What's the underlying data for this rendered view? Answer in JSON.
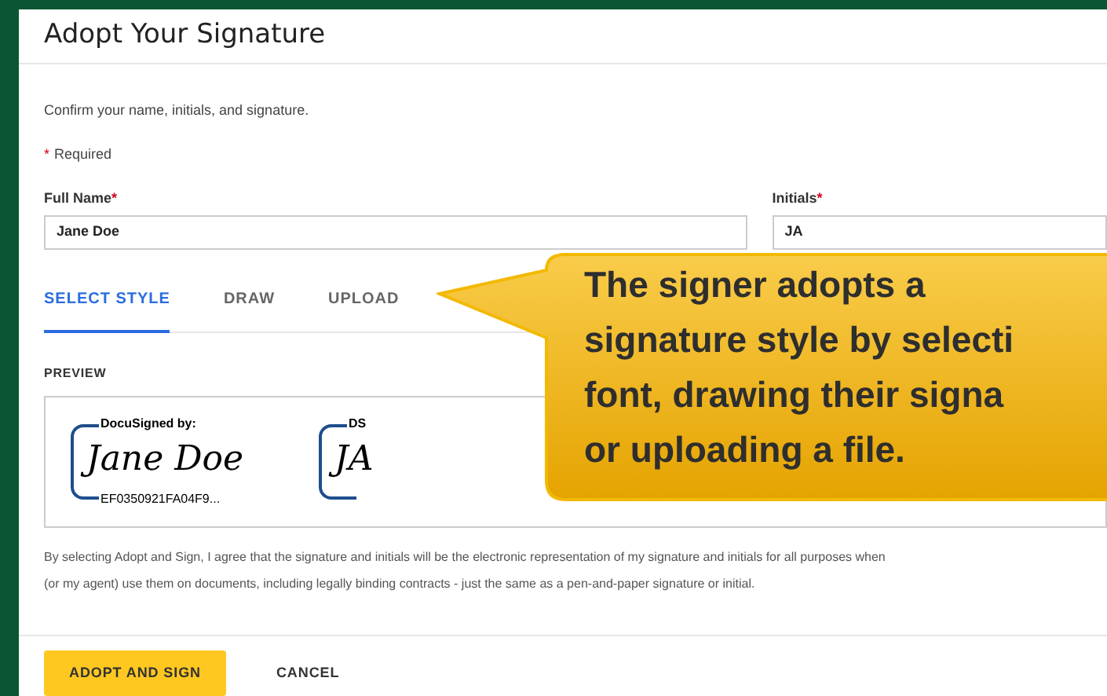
{
  "dialog": {
    "title": "Adopt Your Signature"
  },
  "intro": "Confirm your name, initials, and signature.",
  "required_note": {
    "mark": "*",
    "text": "Required"
  },
  "fields": [
    {
      "label": "Full Name",
      "required": true,
      "value": "Jane Doe"
    },
    {
      "label": "Initials",
      "required": true,
      "value": "JA"
    }
  ],
  "tabs": [
    {
      "label": "SELECT STYLE",
      "selected": true
    },
    {
      "label": "DRAW",
      "selected": false
    },
    {
      "label": "UPLOAD",
      "selected": false
    }
  ],
  "preview": {
    "heading": "PREVIEW",
    "signature": {
      "header": "DocuSigned by:",
      "name": "Jane Doe",
      "id": "EF0350921FA04F9..."
    },
    "initials": {
      "header": "DS",
      "name": "JA"
    }
  },
  "disclaimer": [
    "By selecting Adopt and Sign, I agree that the signature and initials will be the electronic representation of my signature and initials for all purposes when",
    "(or my agent) use them on documents, including legally binding contracts - just the same as a pen-and-paper signature or initial."
  ],
  "buttons": [
    {
      "label": "ADOPT AND SIGN",
      "kind": "primary"
    },
    {
      "label": "CANCEL",
      "kind": "plain"
    }
  ],
  "callout": [
    "The signer adopts a",
    "signature style by selecti",
    "font, drawing their signa",
    "or uploading a file."
  ]
}
